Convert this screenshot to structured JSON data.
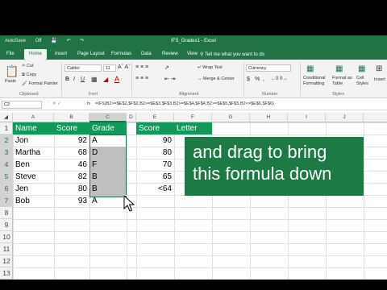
{
  "window": {
    "title": "IFS_Grades1 - Excel",
    "quick_access": [
      "AutoSave",
      "Off",
      "Save",
      "Undo",
      "Redo"
    ]
  },
  "ribbon": {
    "tabs": [
      "File",
      "Home",
      "Insert",
      "Page Layout",
      "Formulas",
      "Data",
      "Review",
      "View"
    ],
    "active_tab": "Home",
    "tell_me": "Tell me what you want to do",
    "clipboard": {
      "paste": "Paste",
      "cut": "Cut",
      "copy": "Copy",
      "format_painter": "Format Painter",
      "group": "Clipboard"
    },
    "font": {
      "name": "Calibri",
      "size": "11",
      "group": "Font",
      "bold": "B",
      "italic": "I",
      "underline": "U"
    },
    "alignment": {
      "wrap": "Wrap Text",
      "merge": "Merge & Center",
      "group": "Alignment"
    },
    "number": {
      "format": "Currency",
      "group": "Number",
      "pct": "%",
      "comma": ","
    },
    "styles": {
      "conditional": "Conditional Formatting",
      "table": "Format as Table",
      "cell": "Cell Styles",
      "group": "Styles"
    },
    "cells": {
      "insert": "Insert"
    }
  },
  "formula_bar": {
    "name_box": "C2",
    "fx": "fx",
    "formula": "=IFS(B2>=$E$2,$F$2,B2>=$E$3,$F$3,B2>=$E$4,$F$4,B2>=$E$5,$F$5,B2<=$E$6,$F$6)"
  },
  "columns": [
    "A",
    "B",
    "C",
    "D",
    "E",
    "F",
    "G",
    "H",
    "I",
    "J"
  ],
  "rows": [
    "1",
    "2",
    "3",
    "4",
    "5",
    "6",
    "7",
    "8",
    "9",
    "10",
    "11",
    "12",
    "13"
  ],
  "sheet": {
    "headers": {
      "name": "Name",
      "score": "Score",
      "grade": "Grade",
      "e": "Score",
      "f": "Letter"
    },
    "students": [
      {
        "name": "Jon",
        "score": "92",
        "grade": "A"
      },
      {
        "name": "Martha",
        "score": "68",
        "grade": "D"
      },
      {
        "name": "Ben",
        "score": "46",
        "grade": "F"
      },
      {
        "name": "Steve",
        "score": "82",
        "grade": "B"
      },
      {
        "name": "Jen",
        "score": "80",
        "grade": "B"
      },
      {
        "name": "Bob",
        "score": "93",
        "grade": "A"
      }
    ],
    "lookup_scores": [
      "90",
      "80",
      "70",
      "65",
      "<64"
    ]
  },
  "overlay": {
    "line1": "and drag to bring",
    "line2": "this formula down"
  },
  "colors": {
    "excel_green": "#217346",
    "header_fill": "#13985c",
    "banner": "#1e7a45"
  }
}
